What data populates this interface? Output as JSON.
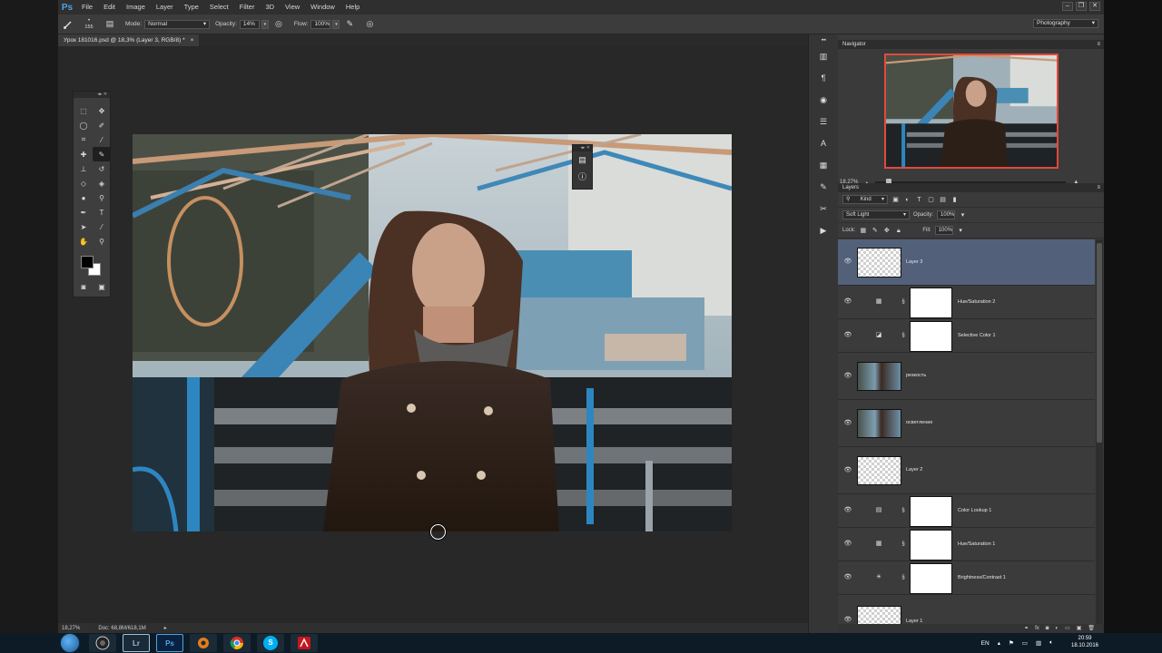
{
  "app": {
    "logo": "Ps"
  },
  "menu": [
    "File",
    "Edit",
    "Image",
    "Layer",
    "Type",
    "Select",
    "Filter",
    "3D",
    "View",
    "Window",
    "Help"
  ],
  "window_controls": [
    "–",
    "❐",
    "✕"
  ],
  "options": {
    "brush_size": "155",
    "mode_label": "Mode:",
    "mode_value": "Normal",
    "opacity_label": "Opacity:",
    "opacity_value": "14%",
    "flow_label": "Flow:",
    "flow_value": "100%",
    "workspace": "Photography"
  },
  "document": {
    "tab_title": "Урок 181016.psd @ 18,3% (Layer 3, RGB/8) *",
    "close": "×"
  },
  "status": {
    "zoom": "18,27%",
    "doc_info": "Doc: 68,8M/618,1M"
  },
  "navigator": {
    "title": "Navigator",
    "zoom": "18,27%"
  },
  "layers_panel": {
    "title": "Layers",
    "filter_kind": "Kind",
    "blend_mode": "Soft Light",
    "opacity_label": "Opacity:",
    "opacity_value": "100%",
    "lock_label": "Lock:",
    "fill_label": "Fill:",
    "fill_value": "100%",
    "layers": [
      {
        "name": "Layer 3",
        "kind": "pixel"
      },
      {
        "name": "Hue/Saturation 2",
        "kind": "adjustment"
      },
      {
        "name": "Selective Color 1",
        "kind": "adjustment"
      },
      {
        "name": "резкость",
        "kind": "photo"
      },
      {
        "name": "осветление",
        "kind": "photo"
      },
      {
        "name": "Layer 2",
        "kind": "pixel"
      },
      {
        "name": "Color Lookup 1",
        "kind": "adjustment"
      },
      {
        "name": "Hue/Saturation 1",
        "kind": "adjustment"
      },
      {
        "name": "Brightness/Contrast 1",
        "kind": "adjustment"
      },
      {
        "name": "Layer 1",
        "kind": "pixel"
      }
    ]
  },
  "taskbar": {
    "apps": [
      "Lr",
      "Ps",
      "S"
    ],
    "language": "EN",
    "time": "20:59",
    "date": "18.10.2016"
  },
  "colors": {
    "accent_selected_layer": "#52607a",
    "navigator_frame": "#e04a3a",
    "ps_blue": "#4fa3e3"
  }
}
